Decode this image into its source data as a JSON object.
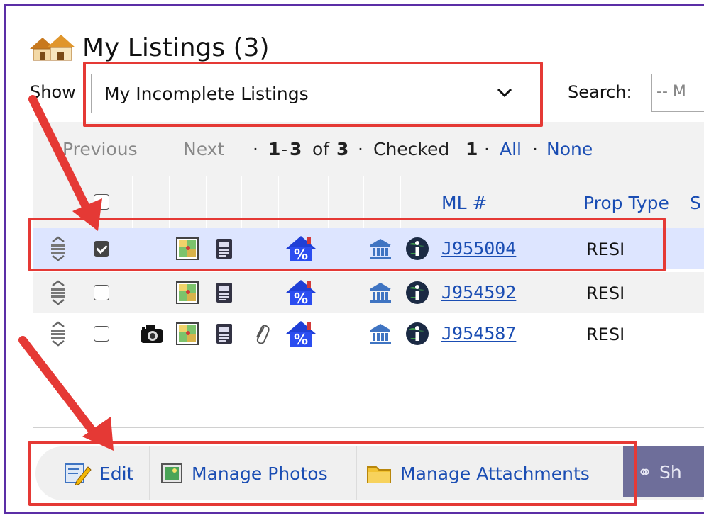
{
  "page": {
    "title": "My Listings (3)",
    "show_label": "Show",
    "show_select_value": "My Incomplete Listings",
    "search_label": "Search:",
    "search_placeholder": "-- M"
  },
  "pager": {
    "previous": "Previous",
    "next": "Next",
    "sep1": "·",
    "range_start": "1",
    "range_dash": "-",
    "range_end": "3",
    "of": "of",
    "total": "3",
    "sep2": "·",
    "checked_label": "Checked",
    "checked_count": "1",
    "sep3": "·",
    "all": "All",
    "sep4": "·",
    "none": "None"
  },
  "columns": {
    "ml": "ML #",
    "prop_type": "Prop Type",
    "next_cut": "S"
  },
  "rows": [
    {
      "checked": true,
      "ml": "J955004",
      "prop_type": "RESI",
      "icons": [
        "reorder-icon",
        "map-icon",
        "listing-doc-icon",
        "house-percent-icon",
        "bank-icon",
        "info-globe-icon"
      ]
    },
    {
      "checked": false,
      "ml": "J954592",
      "prop_type": "RESI",
      "icons": [
        "reorder-icon",
        "map-icon",
        "listing-doc-icon",
        "house-percent-icon",
        "bank-icon",
        "info-globe-icon"
      ]
    },
    {
      "checked": false,
      "ml": "J954587",
      "prop_type": "RESI",
      "icons": [
        "reorder-icon",
        "camera-icon",
        "map-icon",
        "listing-doc-icon",
        "paperclip-icon",
        "house-percent-icon",
        "bank-icon",
        "info-globe-icon"
      ]
    }
  ],
  "toolbar": {
    "edit": "Edit",
    "manage_photos": "Manage Photos",
    "manage_attachments": "Manage Attachments",
    "share_cut": "Sh"
  },
  "colors": {
    "link": "#1a4db3",
    "highlight": "#e53935",
    "selected_row": "#dde5ff",
    "frame": "#5b2ea6"
  }
}
